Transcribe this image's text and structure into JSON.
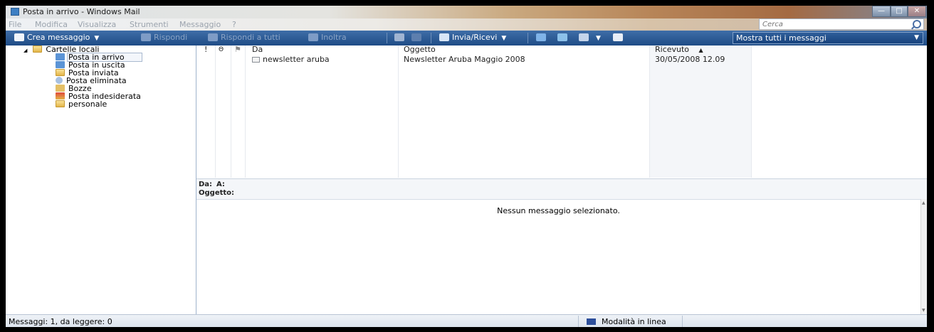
{
  "window": {
    "title": "Posta in arrivo - Windows Mail"
  },
  "menu": [
    "File",
    "Modifica",
    "Visualizza",
    "Strumenti",
    "Messaggio",
    "?"
  ],
  "search": {
    "placeholder": "Cerca"
  },
  "toolbar": {
    "create": "Crea messaggio",
    "reply": "Rispondi",
    "reply_all": "Rispondi a tutti",
    "forward": "Inoltra",
    "send_receive": "Invia/Ricevi",
    "filter": "Mostra tutti i messaggi"
  },
  "folders": {
    "root": "Cartelle locali",
    "items": [
      "Posta in arrivo",
      "Posta in uscita",
      "Posta inviata",
      "Posta eliminata",
      "Bozze",
      "Posta indesiderata",
      "personale"
    ],
    "selected": "Posta in arrivo"
  },
  "list": {
    "columns": {
      "importance": "!",
      "attachment": "Θ",
      "flag": "⚑",
      "from": "Da",
      "subject": "Oggetto",
      "received": "Ricevuto",
      "sort_indicator": "▲"
    },
    "rows": [
      {
        "from": "newsletter aruba",
        "subject": "Newsletter Aruba Maggio 2008",
        "received": "30/05/2008 12.09"
      }
    ]
  },
  "preview": {
    "from_label": "Da:",
    "to_label": "A:",
    "subject_label": "Oggetto:",
    "empty_message": "Nessun messaggio selezionato."
  },
  "status": {
    "left": "Messaggi: 1, da leggere: 0",
    "mode": "Modalità in linea"
  },
  "colors": {
    "toolbar": "#1f4c86",
    "selection_border": "#a9b9cf",
    "folder": "#e3b548"
  }
}
